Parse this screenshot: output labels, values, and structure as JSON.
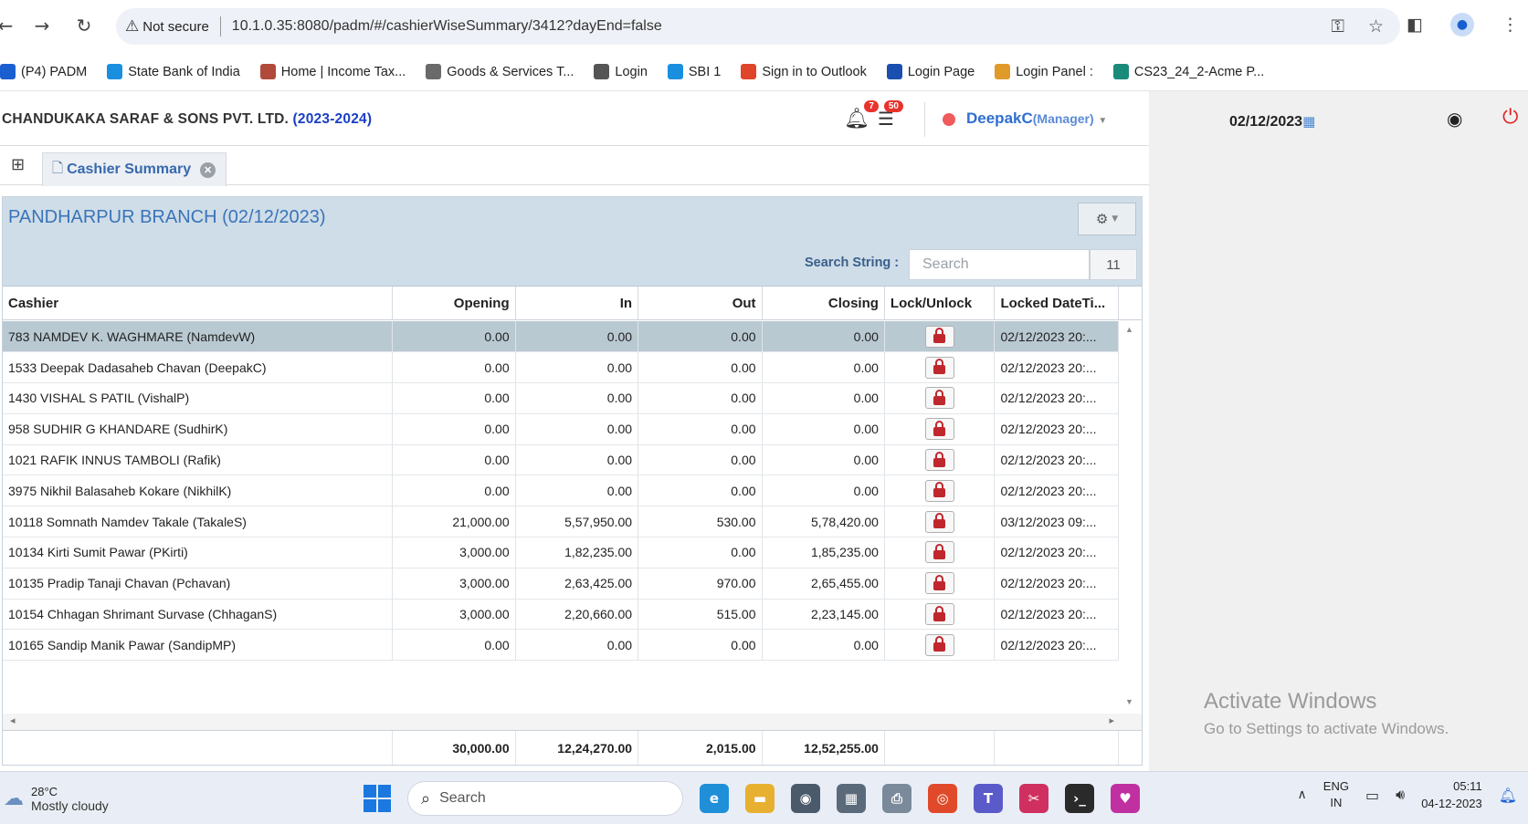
{
  "browser": {
    "security_label": "Not secure",
    "url": "10.1.0.35:8080/padm/#/cashierWiseSummary/3412?dayEnd=false",
    "bookmarks": [
      {
        "label": "(P4) PADM",
        "color": "#1a5fd0"
      },
      {
        "label": "State Bank of India",
        "color": "#1a8fe0"
      },
      {
        "label": "Home | Income Tax...",
        "color": "#b04a3a"
      },
      {
        "label": "Goods & Services T...",
        "color": "#6a6a6a"
      },
      {
        "label": "Login",
        "color": "#555555"
      },
      {
        "label": "SBI 1",
        "color": "#1a8fe0"
      },
      {
        "label": "Sign in to Outlook",
        "color": "#e0452a"
      },
      {
        "label": "Login Page",
        "color": "#1a4fb0"
      },
      {
        "label": "Login Panel :",
        "color": "#e09a2a"
      },
      {
        "label": "CS23_24_2-Acme P...",
        "color": "#1a8a7a"
      }
    ]
  },
  "header": {
    "company": "CHANDUKAKA SARAF & SONS PVT. LTD.",
    "year": "(2023-2024)",
    "notifications_count": "7",
    "messages_count": "50",
    "user": "DeepakC",
    "role": "(Manager)",
    "date": "02/12/2023"
  },
  "tabs": {
    "active_label": "Cashier Summary"
  },
  "panel": {
    "title": "PANDHARPUR BRANCH (02/12/2023)",
    "search_label": "Search String :",
    "search_placeholder": "Search",
    "record_count": "11"
  },
  "table": {
    "columns": [
      "Cashier",
      "Opening",
      "In",
      "Out",
      "Closing",
      "Lock/Unlock",
      "Locked DateTi..."
    ],
    "rows": [
      {
        "cashier": "783 NAMDEV K. WAGHMARE (NamdevW)",
        "opening": "0.00",
        "in": "0.00",
        "out": "0.00",
        "closing": "0.00",
        "locked": "02/12/2023 20:..."
      },
      {
        "cashier": "1533 Deepak Dadasaheb Chavan (DeepakC)",
        "opening": "0.00",
        "in": "0.00",
        "out": "0.00",
        "closing": "0.00",
        "locked": "02/12/2023 20:..."
      },
      {
        "cashier": "1430 VISHAL S PATIL (VishalP)",
        "opening": "0.00",
        "in": "0.00",
        "out": "0.00",
        "closing": "0.00",
        "locked": "02/12/2023 20:..."
      },
      {
        "cashier": "958 SUDHIR G KHANDARE (SudhirK)",
        "opening": "0.00",
        "in": "0.00",
        "out": "0.00",
        "closing": "0.00",
        "locked": "02/12/2023 20:..."
      },
      {
        "cashier": "1021 RAFIK INNUS TAMBOLI (Rafik)",
        "opening": "0.00",
        "in": "0.00",
        "out": "0.00",
        "closing": "0.00",
        "locked": "02/12/2023 20:..."
      },
      {
        "cashier": "3975 Nikhil Balasaheb Kokare (NikhilK)",
        "opening": "0.00",
        "in": "0.00",
        "out": "0.00",
        "closing": "0.00",
        "locked": "02/12/2023 20:..."
      },
      {
        "cashier": "10118 Somnath Namdev Takale (TakaleS)",
        "opening": "21,000.00",
        "in": "5,57,950.00",
        "out": "530.00",
        "closing": "5,78,420.00",
        "locked": "03/12/2023 09:..."
      },
      {
        "cashier": "10134 Kirti Sumit Pawar (PKirti)",
        "opening": "3,000.00",
        "in": "1,82,235.00",
        "out": "0.00",
        "closing": "1,85,235.00",
        "locked": "02/12/2023 20:..."
      },
      {
        "cashier": "10135 Pradip Tanaji Chavan (Pchavan)",
        "opening": "3,000.00",
        "in": "2,63,425.00",
        "out": "970.00",
        "closing": "2,65,455.00",
        "locked": "02/12/2023 20:..."
      },
      {
        "cashier": "10154 Chhagan Shrimant Survase (ChhaganS)",
        "opening": "3,000.00",
        "in": "2,20,660.00",
        "out": "515.00",
        "closing": "2,23,145.00",
        "locked": "02/12/2023 20:..."
      },
      {
        "cashier": "10165 Sandip Manik Pawar (SandipMP)",
        "opening": "0.00",
        "in": "0.00",
        "out": "0.00",
        "closing": "0.00",
        "locked": "02/12/2023 20:..."
      }
    ],
    "totals": {
      "opening": "30,000.00",
      "in": "12,24,270.00",
      "out": "2,015.00",
      "closing": "12,52,255.00"
    }
  },
  "watermark": {
    "line1": "Activate Windows",
    "line2": "Go to Settings to activate Windows."
  },
  "taskbar": {
    "temperature": "28°C",
    "condition": "Mostly cloudy",
    "search_placeholder": "Search",
    "lang1": "ENG",
    "lang2": "IN",
    "time": "05:11",
    "date": "04-12-2023"
  }
}
